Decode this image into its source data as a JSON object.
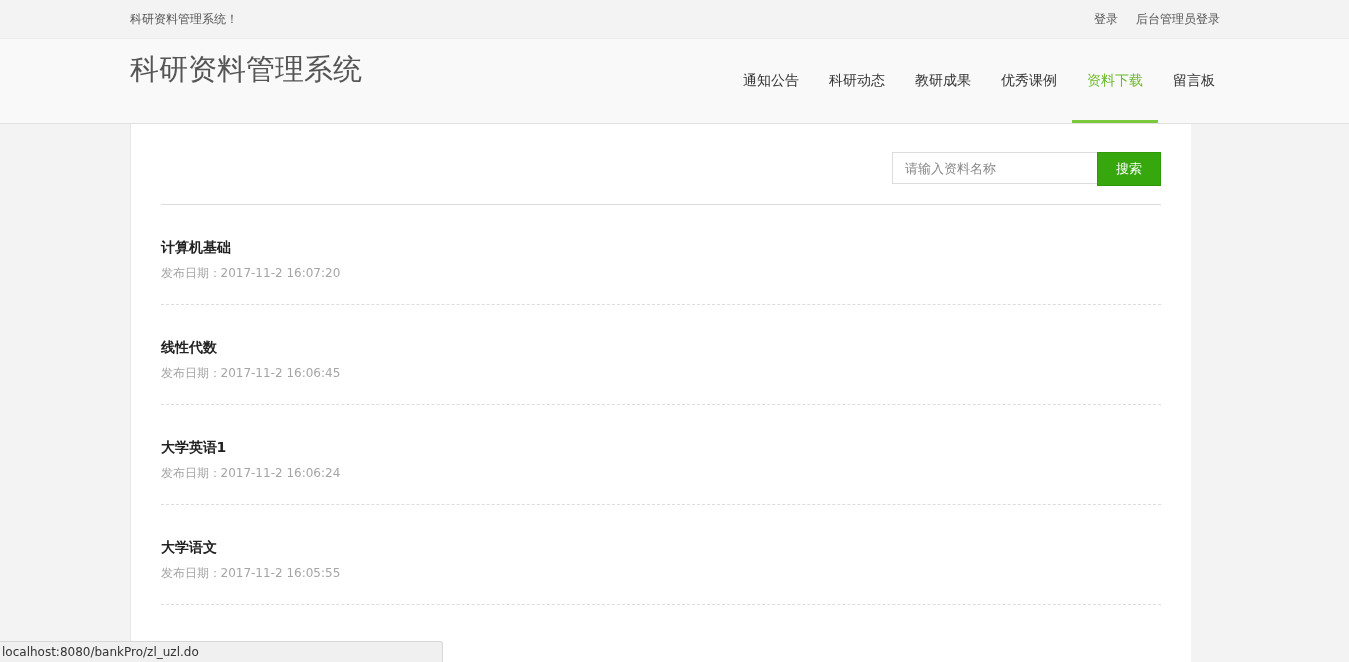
{
  "top_bar": {
    "site_name": "科研资料管理系统！",
    "links": [
      "登录",
      "后台管理员登录"
    ]
  },
  "header": {
    "logo": "科研资料管理系统",
    "nav": [
      {
        "label": "通知公告",
        "selected": false
      },
      {
        "label": "科研动态",
        "selected": false
      },
      {
        "label": "教研成果",
        "selected": false
      },
      {
        "label": "优秀课例",
        "selected": false
      },
      {
        "label": "资料下载",
        "selected": true
      },
      {
        "label": "留言板",
        "selected": false
      }
    ]
  },
  "search": {
    "placeholder": "请输入资料名称",
    "button": "搜索"
  },
  "documents": [
    {
      "title": "计算机基础",
      "date": "发布日期：2017-11-2 16:07:20"
    },
    {
      "title": "线性代数",
      "date": "发布日期：2017-11-2 16:06:45"
    },
    {
      "title": "大学英语1",
      "date": "发布日期：2017-11-2 16:06:24"
    },
    {
      "title": "大学语文",
      "date": "发布日期：2017-11-2 16:05:55"
    }
  ],
  "status_bar": {
    "url": "localhost:8080/bankPro/zl_uzl.do"
  }
}
